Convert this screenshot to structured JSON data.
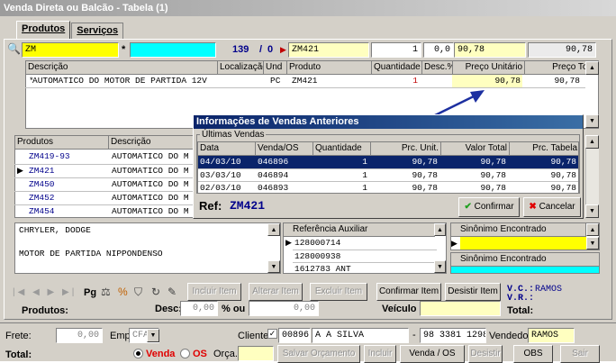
{
  "window": {
    "title": "Venda Direta ou Balcão - Tabela (1)"
  },
  "tabs": [
    {
      "label": "Produtos"
    },
    {
      "label": "Serviços"
    }
  ],
  "search": {
    "code": "ZM",
    "count": "139",
    "separator": "/",
    "index": "0",
    "product": "ZM421",
    "qty": "1",
    "disc": "0,0",
    "price": "90,78",
    "total": "90,78"
  },
  "items_grid": {
    "headers": [
      "Descrição",
      "Localização",
      "Und",
      "Produto",
      "Quantidade",
      "Desc.%",
      "Preço Unitário",
      "Preço Total"
    ],
    "rows": [
      {
        "marker": "*",
        "desc": "AUTOMATICO DO MOTOR DE PARTIDA 12V",
        "loc": "",
        "und": "PC",
        "prod": "ZM421",
        "qty": "1",
        "disc": "",
        "unit": "90,78",
        "total": "90,78"
      }
    ]
  },
  "products_grid": {
    "headers": [
      "Produtos",
      "Descrição"
    ],
    "rows": [
      {
        "code": "ZM419-93",
        "desc": "AUTOMATICO DO M"
      },
      {
        "code": "ZM421",
        "desc": "AUTOMATICO DO M",
        "current": true
      },
      {
        "code": "ZM450",
        "desc": "AUTOMATICO DO M"
      },
      {
        "code": "ZM452",
        "desc": "AUTOMATICO DO M"
      },
      {
        "code": "ZM454",
        "desc": "AUTOMATICO DO M"
      }
    ]
  },
  "notes": {
    "line1": "CHRYLER, DODGE",
    "line2": "MOTOR DE PARTIDA NIPPONDENSO"
  },
  "aux_ref": {
    "header": "Referência Auxiliar",
    "items": [
      "128000714",
      "128000938",
      "1612783 ANT"
    ]
  },
  "synonyms": {
    "header1": "Sinônimo Encontrado",
    "header2": "Sinônimo Encontrado"
  },
  "dialog": {
    "title": "Informações de Vendas Anteriores",
    "group": "Últimas Vendas",
    "headers": [
      "Data",
      "Venda/OS",
      "Quantidade",
      "Prc. Unit.",
      "Valor Total",
      "Prc. Tabela"
    ],
    "rows": [
      [
        "04/03/10",
        "046896",
        "1",
        "90,78",
        "90,78",
        "90,78"
      ],
      [
        "03/03/10",
        "046894",
        "1",
        "90,78",
        "90,78",
        "90,78"
      ],
      [
        "02/03/10",
        "046893",
        "1",
        "90,78",
        "90,78",
        "90,78"
      ]
    ],
    "ref_label": "Ref:",
    "ref_value": "ZM421",
    "confirm": "Confirmar",
    "cancel": "Cancelar"
  },
  "toolbar": {
    "pg": "Pg",
    "incluir": "Incluir Item",
    "alterar": "Alterar Item",
    "excluir": "Excluir Item",
    "confirmar": "Confirmar Item",
    "desistir": "Desistir Item",
    "vc": "V.C.:",
    "vc_val": "RAMOS",
    "vr": "V.R.:"
  },
  "totals": {
    "produtos": "Produtos:",
    "desc": "Desc:",
    "desc_val": "0,00",
    "pct": "% ou",
    "pct_val": "0,00",
    "veiculo": "Veículo",
    "total": "Total:"
  },
  "footer": {
    "frete": "Frete:",
    "frete_val": "0,00",
    "emp": "Emp:",
    "emp_val": "CFA",
    "cliente": "Cliente:",
    "cli_code": "00896",
    "cli_name": "A A SILVA",
    "phone": "98 3381 1298",
    "vendedor": "Vendedor:",
    "vend_val": "RAMOS",
    "total": "Total:",
    "venda": "Venda",
    "os": "OS",
    "orca": "Orça.:",
    "salvar": "Salvar Orçamento",
    "incluir": "Incluir",
    "vendaos": "Venda / OS",
    "desistir": "Desistir",
    "obs": "OBS",
    "sair": "Sair"
  },
  "colors": {
    "title_grad": "#9c9c9c",
    "yellow": "#ffff00",
    "cyan": "#00ffff",
    "dlg_title": "#0a246a",
    "sel_row": "#0a246a",
    "red": "#ff0000",
    "blue_text": "#00008b"
  }
}
